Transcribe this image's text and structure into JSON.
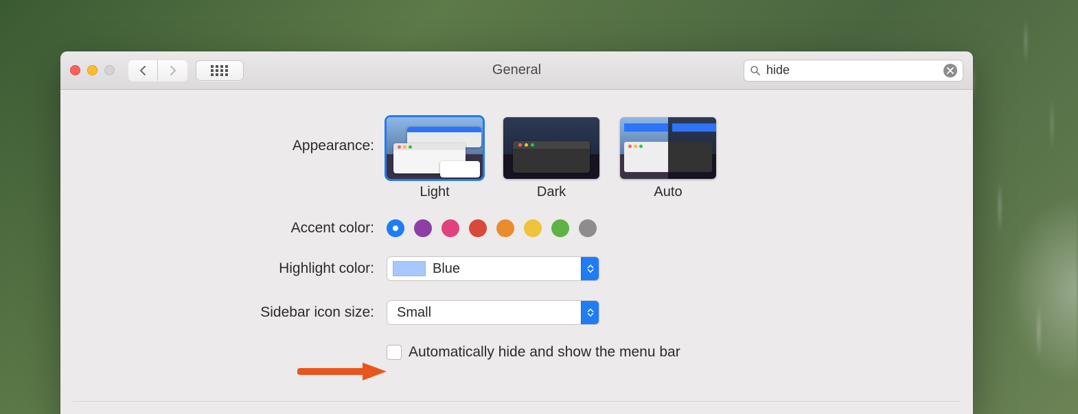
{
  "window": {
    "title": "General"
  },
  "search": {
    "value": "hide"
  },
  "appearance": {
    "label": "Appearance:",
    "options": [
      {
        "name": "Light",
        "selected": true
      },
      {
        "name": "Dark",
        "selected": false
      },
      {
        "name": "Auto",
        "selected": false
      }
    ]
  },
  "accent": {
    "label": "Accent color:",
    "colors": [
      {
        "hex": "#1f7cf4",
        "selected": true
      },
      {
        "hex": "#8e3fa6"
      },
      {
        "hex": "#e0427f"
      },
      {
        "hex": "#d9483a"
      },
      {
        "hex": "#ea8c2e"
      },
      {
        "hex": "#efc33c"
      },
      {
        "hex": "#5fb245"
      },
      {
        "hex": "#8e8c8c"
      }
    ]
  },
  "highlight": {
    "label": "Highlight color:",
    "value": "Blue",
    "swatch": "#a6c8ff"
  },
  "sidebar_size": {
    "label": "Sidebar icon size:",
    "value": "Small"
  },
  "auto_hide_menubar": {
    "label": "Automatically hide and show the menu bar",
    "checked": false
  }
}
